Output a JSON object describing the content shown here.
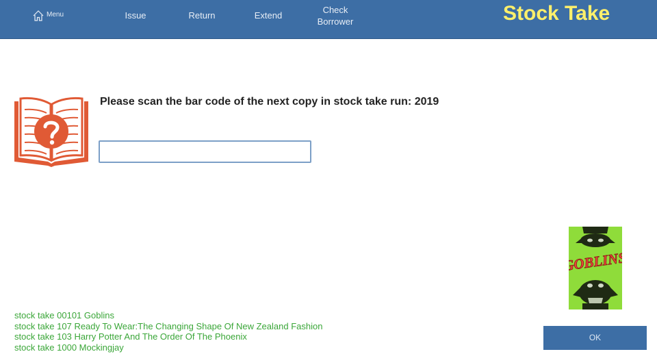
{
  "nav": {
    "menu_label": "Menu",
    "items": [
      {
        "label": "Issue"
      },
      {
        "label": "Return"
      },
      {
        "label": "Extend"
      },
      {
        "label": "Check Borrower"
      }
    ]
  },
  "header": {
    "title": "Stock Take"
  },
  "colors": {
    "nav_bg": "#3d6ea5",
    "title_color": "#fff06b",
    "icon_orange": "#e05a35",
    "log_green": "#3aa638"
  },
  "main": {
    "prompt": "Please scan the bar code of the next copy in stock take run: 2019",
    "barcode_value": "",
    "barcode_placeholder": ""
  },
  "cover": {
    "title": "GOBLINS"
  },
  "log": [
    {
      "text": "stock take  00101 Goblins"
    },
    {
      "text": "stock take  107 Ready To Wear:The Changing Shape Of New Zealand Fashion"
    },
    {
      "text": "stock take  103 Harry Potter And The Order Of The Phoenix"
    },
    {
      "text": "stock take  1000 Mockingjay"
    }
  ],
  "actions": {
    "ok_label": "OK"
  }
}
